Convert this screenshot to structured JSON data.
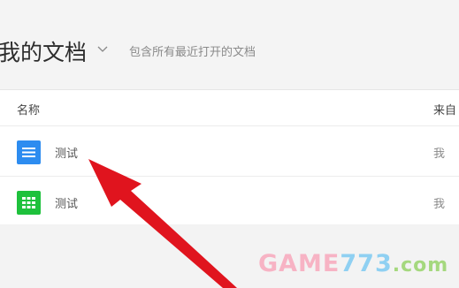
{
  "header": {
    "title": "我的文档",
    "subtitle": "包含所有最近打开的文档"
  },
  "table": {
    "columns": {
      "name": "名称",
      "from": "来自"
    },
    "rows": [
      {
        "icon": "doc-icon",
        "name": "测试",
        "owner": "我"
      },
      {
        "icon": "sheet-icon",
        "name": "测试",
        "owner": "我"
      }
    ]
  },
  "watermark": {
    "part1": "GAME",
    "part2": "773",
    "part3": ".com"
  },
  "colors": {
    "doc": "#2d8cf0",
    "sheet": "#1ec13c",
    "arrow": "#e0141e"
  }
}
